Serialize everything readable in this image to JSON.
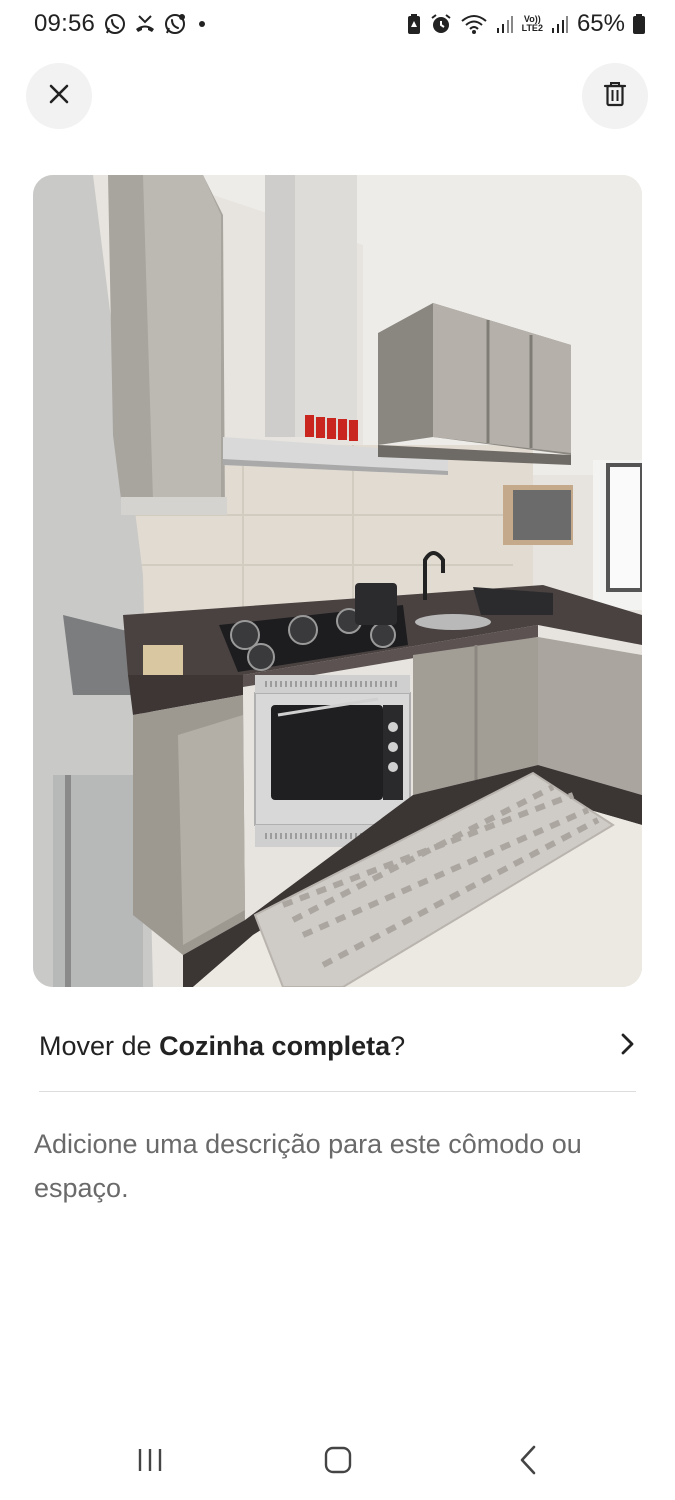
{
  "status_bar": {
    "time": "09:56",
    "left_icons": [
      "whatsapp-icon",
      "missed-call-icon",
      "whatsapp-business-icon",
      "notification-dot"
    ],
    "right_icons": [
      "battery-saver-icon",
      "alarm-icon",
      "wifi-icon",
      "signal-icon",
      "volte-icon",
      "signal-icon"
    ],
    "volte_line1": "Vo))",
    "volte_line2": "LTE2",
    "battery_percent": "65%"
  },
  "top_bar": {
    "close_icon": "close-icon",
    "delete_icon": "trash-icon"
  },
  "photo": {
    "description_kind": "kitchen-photo"
  },
  "move_row": {
    "prefix": "Mover de ",
    "room": "Cozinha completa",
    "suffix": "?",
    "chevron_icon": "chevron-right-icon"
  },
  "description": {
    "placeholder": "Adicione uma descrição para este cômodo ou espaço."
  },
  "nav_bar": {
    "items": [
      "recents-icon",
      "home-icon",
      "back-icon"
    ]
  },
  "colors": {
    "button_bg": "#f2f2f2",
    "text_primary": "#222222",
    "text_secondary": "#6a6a6a",
    "divider": "#dddddd"
  }
}
